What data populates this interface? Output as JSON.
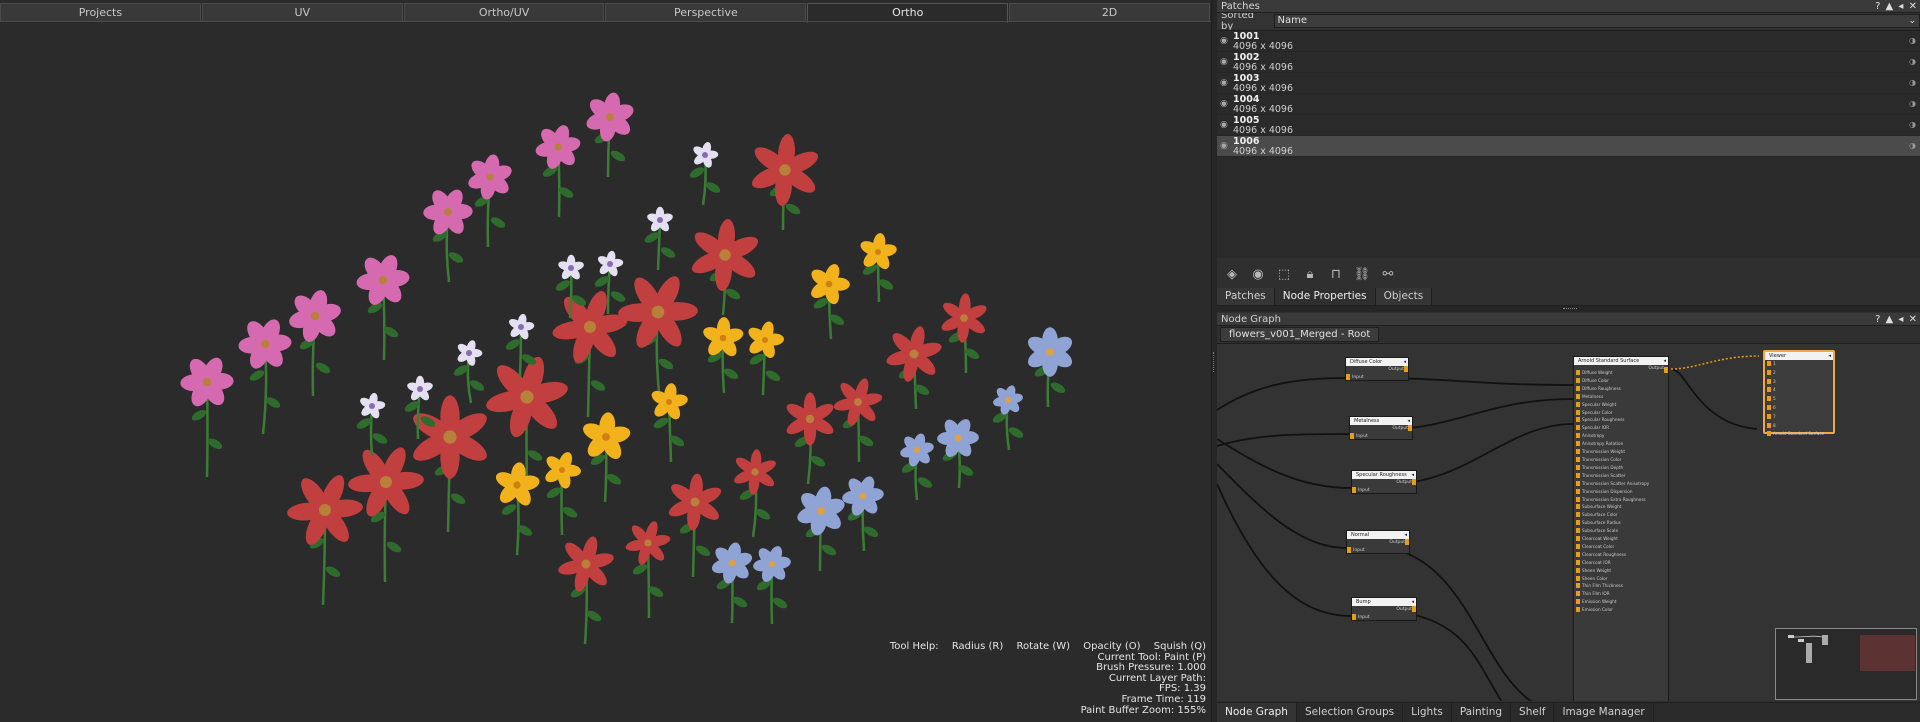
{
  "viewport": {
    "tabs": [
      "Projects",
      "UV",
      "Ortho/UV",
      "Perspective",
      "Ortho",
      "2D"
    ],
    "active_tab": "Ortho",
    "tool_help": {
      "label": "Tool Help:",
      "items": [
        "Radius (R)",
        "Rotate (W)",
        "Opacity (O)",
        "Squish (Q)"
      ],
      "lines": [
        "Current Tool: Paint (P)",
        "Brush Pressure: 1.000",
        "Current Layer Path:",
        "FPS: 1.39",
        "Frame Time: 119",
        "Paint Buffer Zoom: 155%"
      ]
    }
  },
  "patches": {
    "title": "Patches",
    "controls": "? ▲ ◂ ✕",
    "sorted_by_label": "Sorted by",
    "sorted_by_value": "Name",
    "items": [
      {
        "name": "1001",
        "size": "4096 x 4096"
      },
      {
        "name": "1002",
        "size": "4096 x 4096"
      },
      {
        "name": "1003",
        "size": "4096 x 4096"
      },
      {
        "name": "1004",
        "size": "4096 x 4096"
      },
      {
        "name": "1005",
        "size": "4096 x 4096"
      },
      {
        "name": "1006",
        "size": "4096 x 4096"
      }
    ],
    "selected_index": 5
  },
  "panel_tabs": [
    "Patches",
    "Node Properties",
    "Objects"
  ],
  "active_panel_tab": "Node Properties",
  "node_graph": {
    "title": "Node Graph",
    "controls": "? ▲ ◂ ✕",
    "breadcrumb": "flowers_v001_Merged - Root",
    "nodes": {
      "diffuse": {
        "title": "Diffuse Color",
        "output": "Output",
        "input": "Input"
      },
      "metalness": {
        "title": "Metalness",
        "output": "Output",
        "input": "Input"
      },
      "specular": {
        "title": "Specular Roughness",
        "output": "Output",
        "input": "Input"
      },
      "normal": {
        "title": "Normal",
        "output": "Output",
        "input": "Input"
      },
      "bump": {
        "title": "Bump",
        "output": "Output",
        "input": "Input"
      },
      "surface": {
        "title": "Arnold Standard Surface",
        "output": "Output",
        "ports": [
          "Diffuse Weight",
          "Diffuse Color",
          "Diffuse Roughness",
          "Metalness",
          "Specular Weight",
          "Specular Color",
          "Specular Roughness",
          "Specular IOR",
          "Anisotropy",
          "Anisotropy Rotation",
          "Transmission Weight",
          "Transmission Color",
          "Transmission Depth",
          "Transmission Scatter",
          "Transmission Scatter Anisotropy",
          "Transmission Dispersion",
          "Transmission Extra Roughness",
          "Subsurface Weight",
          "Subsurface Color",
          "Subsurface Radius",
          "Subsurface Scale",
          "Clearcoat Weight",
          "Clearcoat Color",
          "Clearcoat Roughness",
          "Clearcoat IOR",
          "Sheen Weight",
          "Sheen Color",
          "Thin Film Thickness",
          "Thin Film IOR",
          "Emission Weight",
          "Emission Color"
        ]
      },
      "viewer": {
        "title": "Viewer",
        "ports": [
          "1",
          "2",
          "3",
          "4",
          "5",
          "6",
          "7",
          "8",
          "9"
        ],
        "last_port": "Arnold Standard Surface"
      }
    }
  },
  "bottom_tabs": [
    "Node Graph",
    "Selection Groups",
    "Lights",
    "Painting",
    "Shelf",
    "Image Manager"
  ],
  "active_bottom_tab": "Node Graph",
  "colors": {
    "accent_orange": "#e89d12",
    "viewer_border": "#f0a74a",
    "pink_flower": "#d66ab0",
    "red_flower": "#c23f3f",
    "yellow_flower": "#f2b21c",
    "blue_flower": "#8fa4d4",
    "white_flower": "#e4e0f2",
    "stem": "#3c7d36"
  }
}
